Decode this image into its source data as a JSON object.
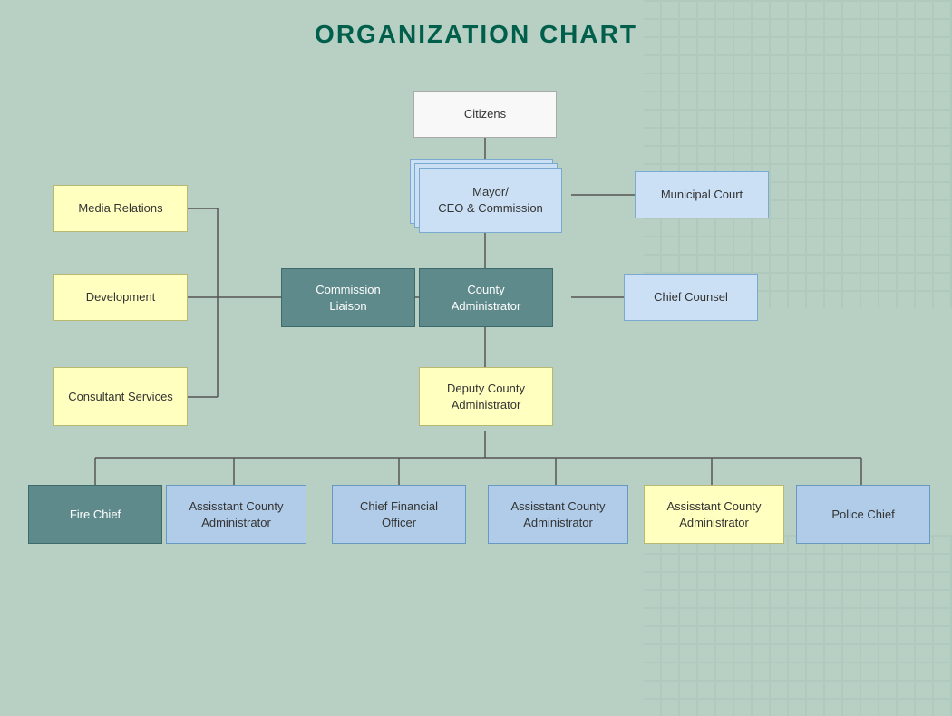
{
  "title": "ORGANIZATION CHART",
  "boxes": {
    "citizens": {
      "label": "Citizens"
    },
    "mayor": {
      "label": "Mayor/\nCEO & Commission"
    },
    "municipal_court": {
      "label": "Municipal Court"
    },
    "media_relations": {
      "label": "Media Relations"
    },
    "development": {
      "label": "Development"
    },
    "consultant_services": {
      "label": "Consultant Services"
    },
    "commission_liaison": {
      "label": "Commission\nLiaison"
    },
    "county_administrator": {
      "label": "County\nAdministrator"
    },
    "chief_counsel": {
      "label": "Chief Counsel"
    },
    "deputy_county_admin": {
      "label": "Deputy County\nAdministrator"
    },
    "fire_chief": {
      "label": "Fire Chief"
    },
    "asst_county_admin_1": {
      "label": "Assisstant County\nAdministrator"
    },
    "cfo": {
      "label": "Chief Financial\nOfficer"
    },
    "asst_county_admin_2": {
      "label": "Assisstant County\nAdministrator"
    },
    "asst_county_admin_3": {
      "label": "Assisstant County\nAdministrator"
    },
    "police_chief": {
      "label": "Police Chief"
    }
  }
}
